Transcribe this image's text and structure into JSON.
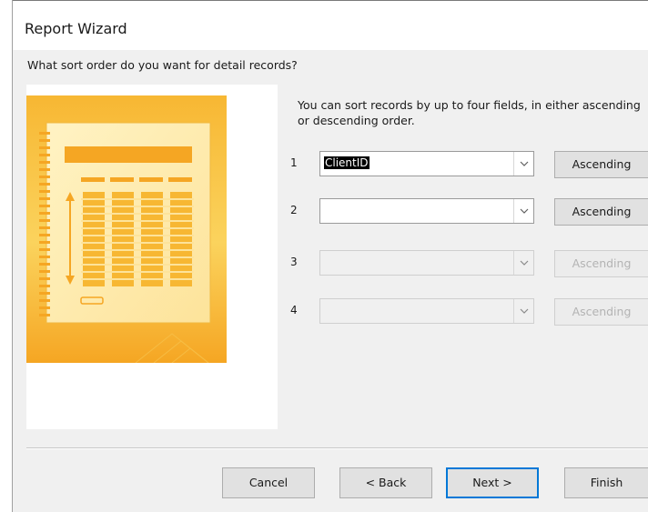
{
  "window": {
    "title": "Report Wizard"
  },
  "prompt": "What sort order do you want for detail records?",
  "description": "You can sort records by up to four fields, in either ascending or descending order.",
  "sort_fields": [
    {
      "number": "1",
      "value": "ClientID",
      "order": "Ascending",
      "enabled": true
    },
    {
      "number": "2",
      "value": "",
      "order": "Ascending",
      "enabled": true
    },
    {
      "number": "3",
      "value": "",
      "order": "Ascending",
      "enabled": false
    },
    {
      "number": "4",
      "value": "",
      "order": "Ascending",
      "enabled": false
    }
  ],
  "buttons": {
    "cancel": "Cancel",
    "back": "< Back",
    "next": "Next >",
    "finish": "Finish"
  },
  "colors": {
    "illustration_orange": "#f5a623",
    "illustration_yellow": "#fde6a0",
    "default_button_border": "#0078d7"
  }
}
